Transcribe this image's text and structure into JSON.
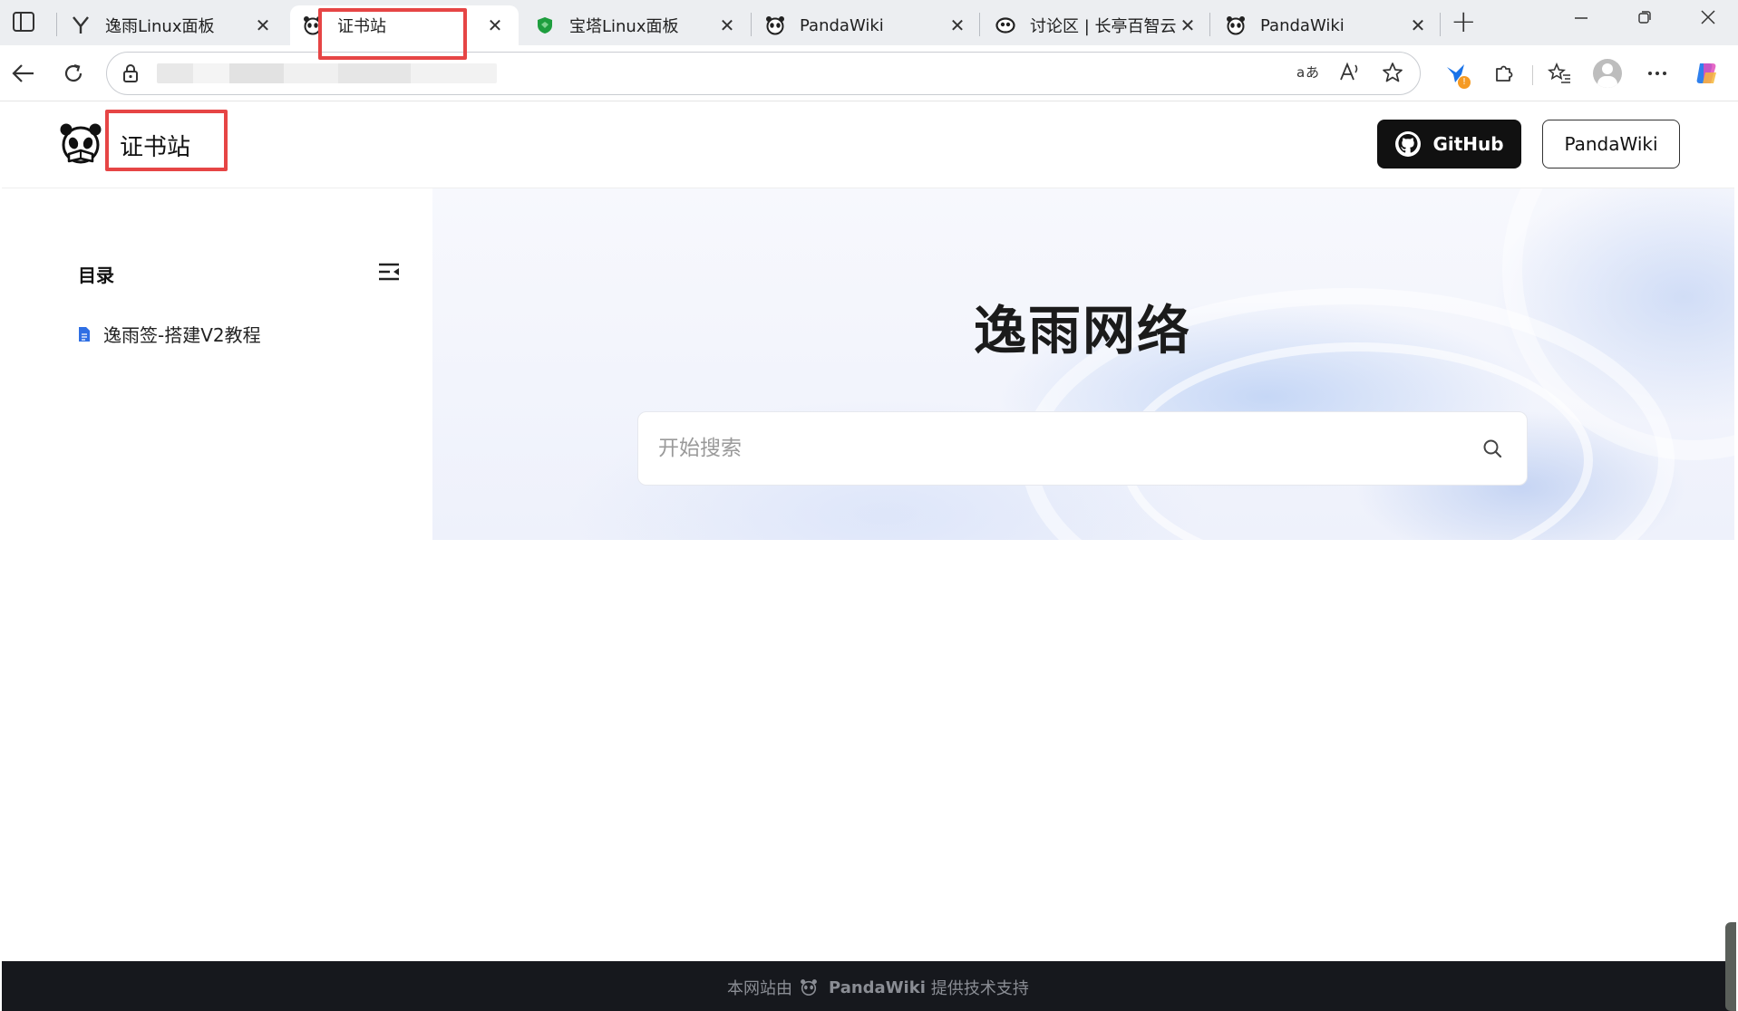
{
  "browser": {
    "tabs": [
      {
        "title": "逸雨Linux面板",
        "favicon": "y-logo-icon",
        "active": false
      },
      {
        "title": "证书站",
        "favicon": "panda-icon",
        "active": true
      },
      {
        "title": "宝塔Linux面板",
        "favicon": "shield-green-icon",
        "active": false
      },
      {
        "title": "PandaWiki",
        "favicon": "panda-icon",
        "active": false
      },
      {
        "title": "讨论区 | 长亭百智云",
        "favicon": "eye-icon",
        "active": false
      },
      {
        "title": "PandaWiki",
        "favicon": "panda-icon",
        "active": false
      }
    ],
    "close_glyph": "✕",
    "new_tab_glyph": "+",
    "address": {
      "url": "",
      "blurred": true
    }
  },
  "site": {
    "name": "证书站",
    "github_label": "GitHub",
    "pandawiki_label": "PandaWiki"
  },
  "toc": {
    "title": "目录",
    "items": [
      {
        "label": "逸雨签-搭建V2教程"
      }
    ]
  },
  "hero": {
    "title": "逸雨网络",
    "search_placeholder": "开始搜索"
  },
  "footer": {
    "prefix": "本网站由",
    "brand": "PandaWiki",
    "suffix": "提供技术支持"
  },
  "colors": {
    "accent_blue": "#2f6fe4",
    "github_bg": "#111111",
    "footer_bg": "#16181d",
    "highlight_red": "#e64545"
  }
}
